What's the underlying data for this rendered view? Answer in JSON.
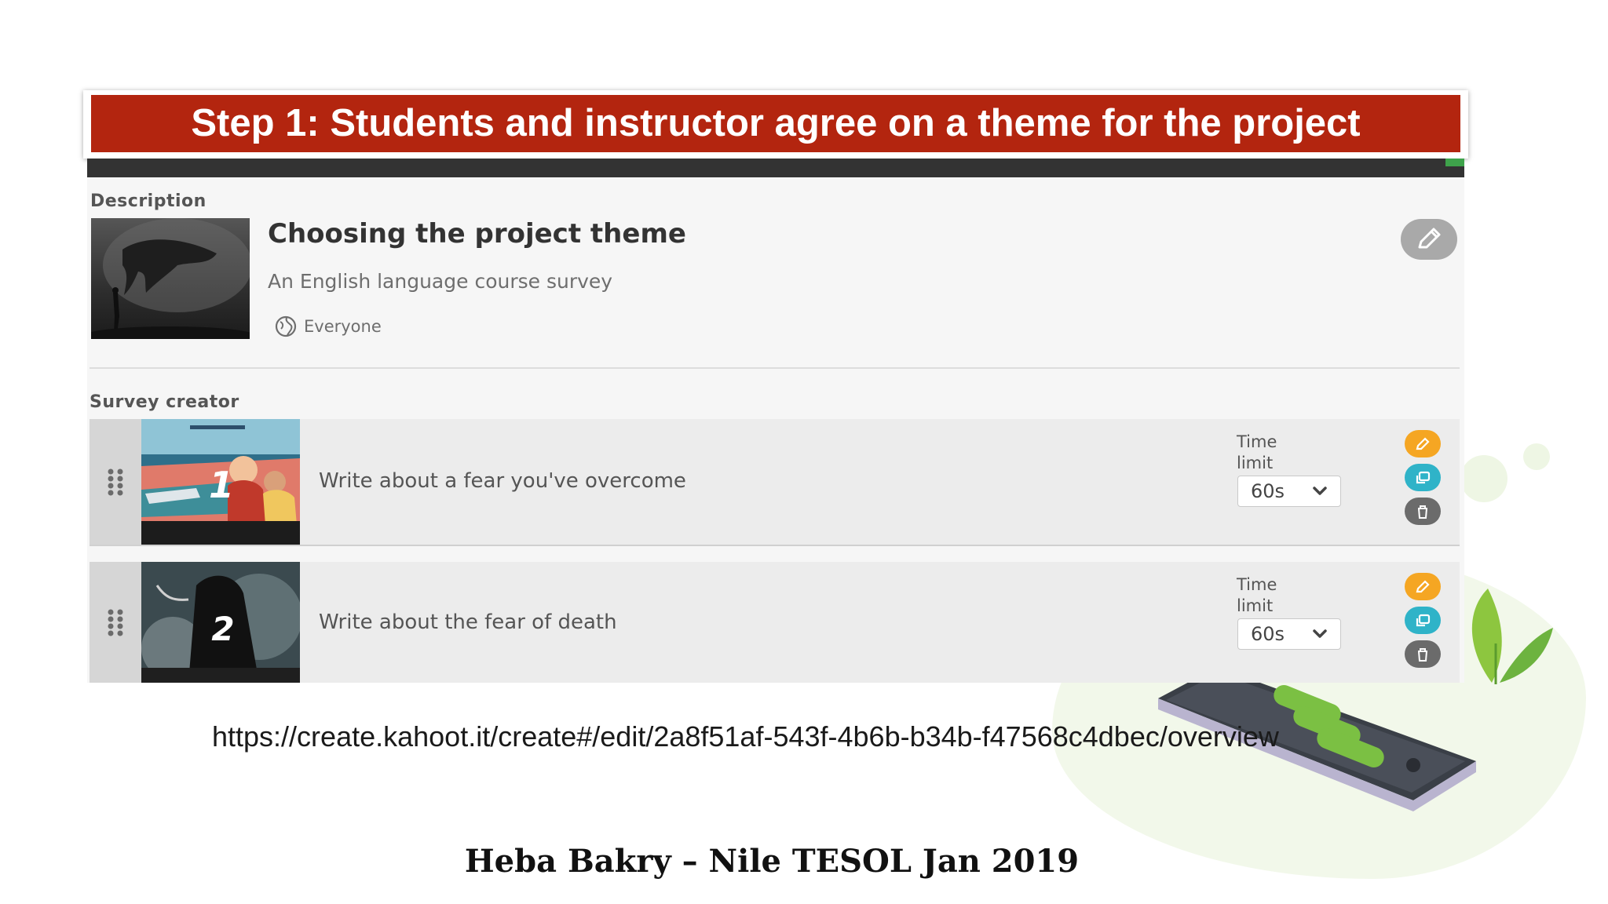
{
  "slide": {
    "title": "Step 1: Students and instructor agree on a theme for the project",
    "url": "https://create.kahoot.it/create#/edit/2a8f51af-543f-4b6b-b34b-f47568c4dbec/overview",
    "footer": "Heba Bakry – Nile TESOL Jan 2019"
  },
  "kahoot": {
    "description_label": "Description",
    "title": "Choosing the project theme",
    "subtitle": "An English language course survey",
    "visibility": "Everyone",
    "survey_creator_label": "Survey creator",
    "questions": [
      {
        "number": "1",
        "text": "Write about a fear you've overcome",
        "time_limit_label": "Time limit",
        "time_limit": "60s"
      },
      {
        "number": "2",
        "text": "Write about the fear of death",
        "time_limit_label": "Time limit",
        "time_limit": "60s"
      }
    ]
  },
  "colors": {
    "banner": "#b3250f",
    "edit_button": "#f5a623",
    "duplicate_button": "#2fb3c8",
    "delete_button": "#6b6b6b"
  },
  "icons": [
    "pencil-icon",
    "globe-icon",
    "drag-handle-icon",
    "chevron-down-icon",
    "duplicate-icon",
    "trash-icon"
  ]
}
